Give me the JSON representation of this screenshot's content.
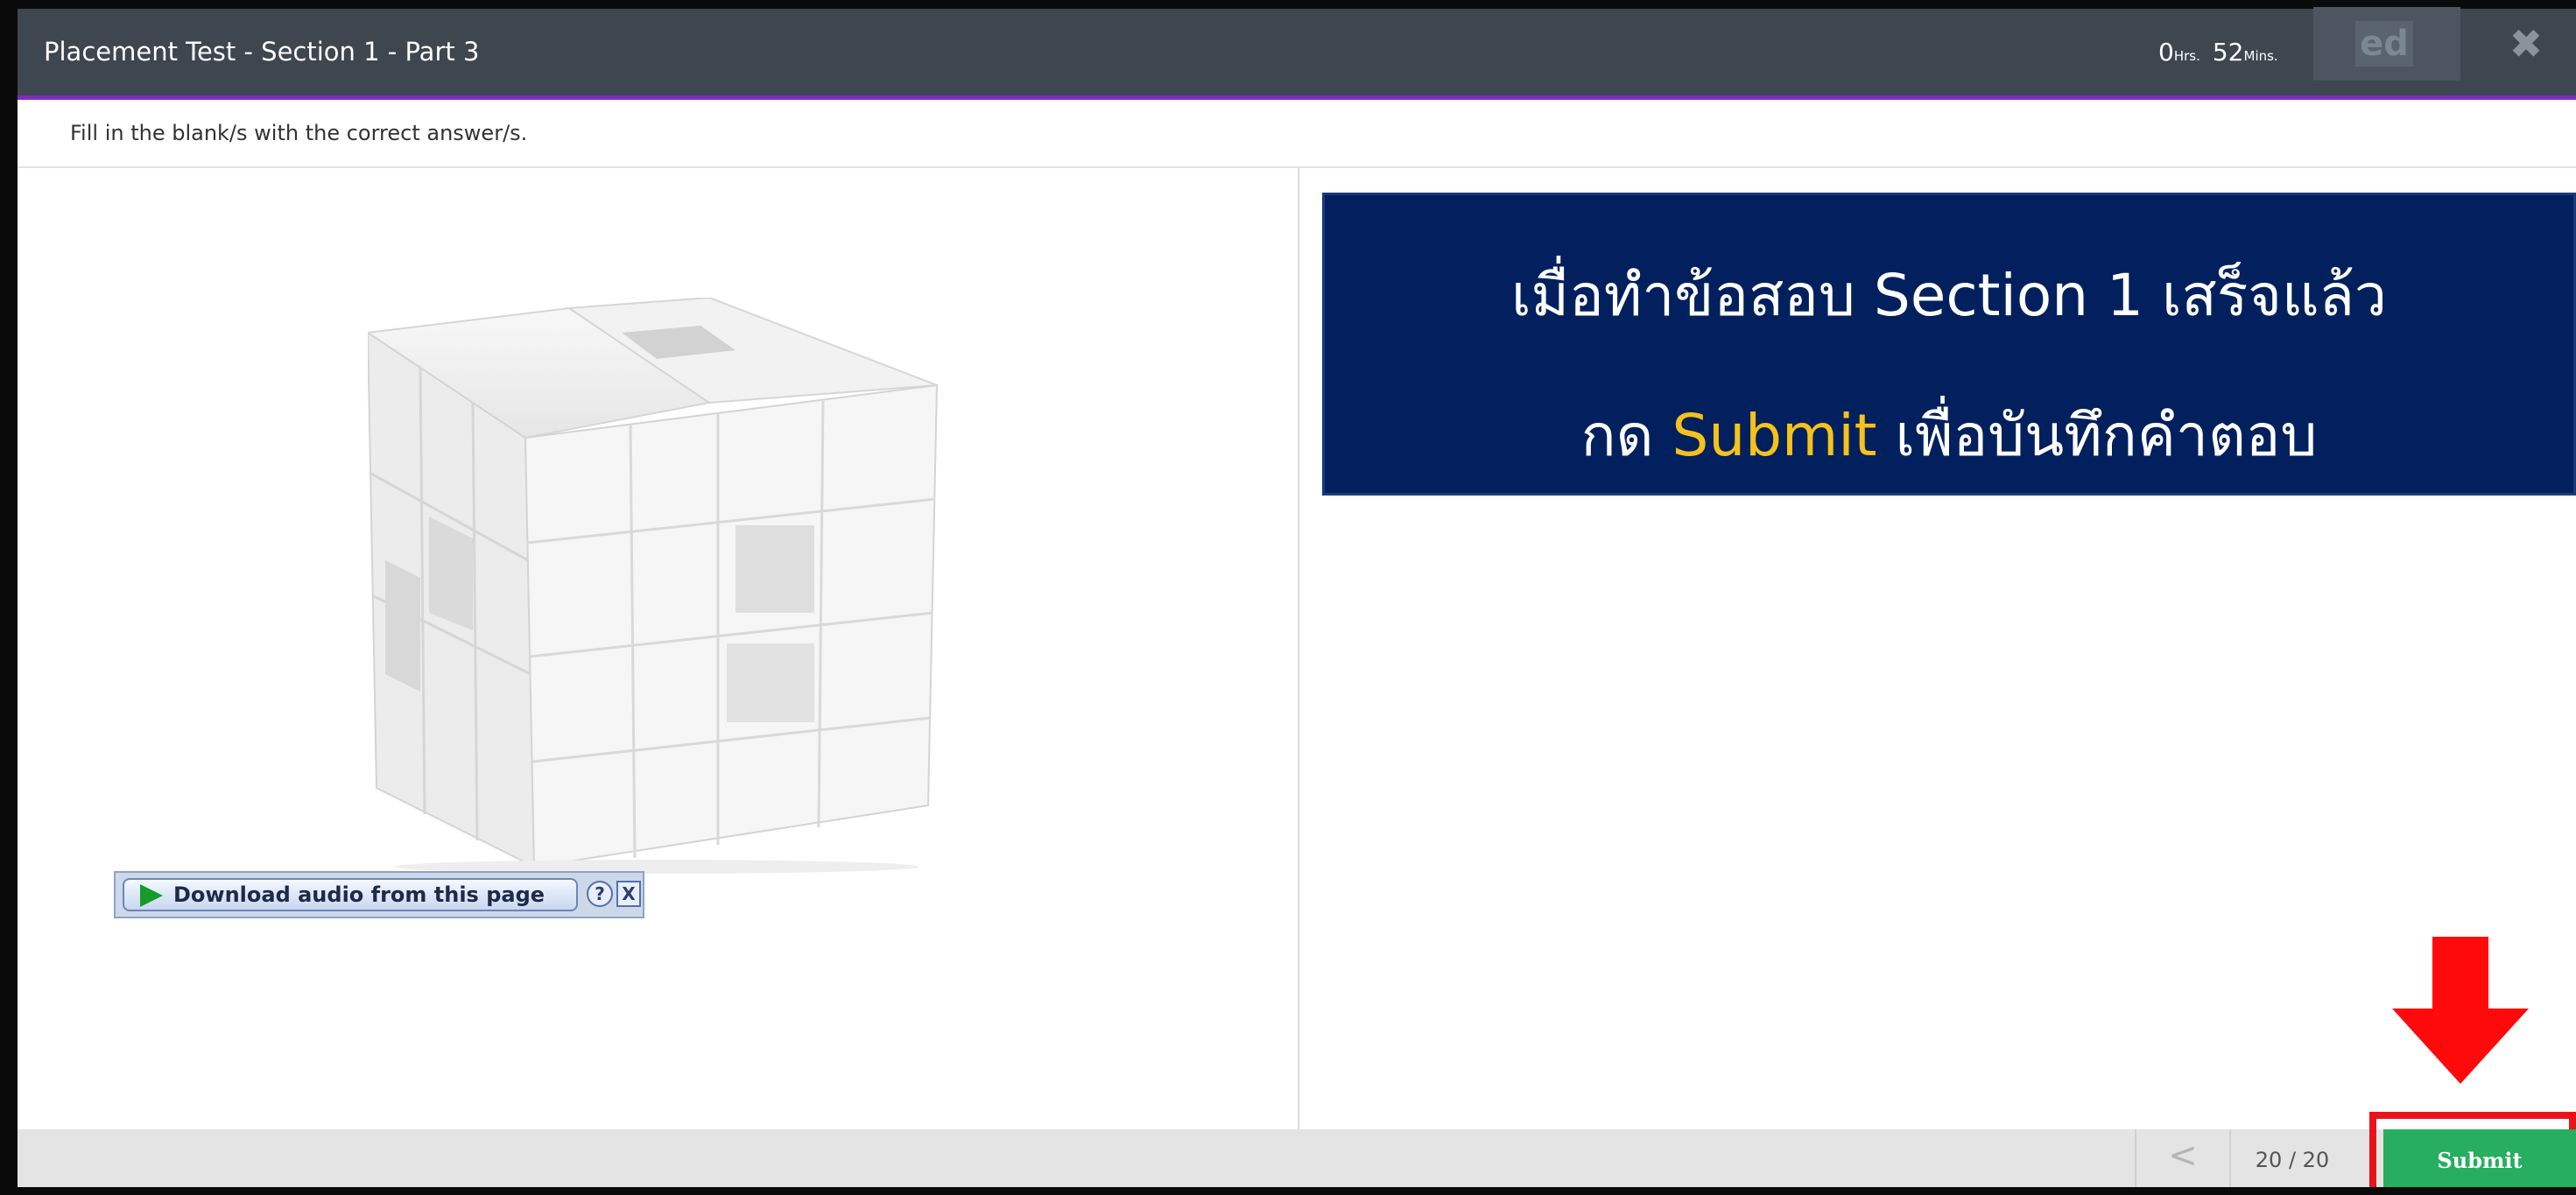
{
  "header": {
    "title": "Placement Test - Section 1 - Part 3",
    "timer": {
      "hours": "0",
      "hours_unit": "Hrs.",
      "minutes": "52",
      "minutes_unit": "Mins."
    },
    "logo_text": "ed",
    "close_glyph": "✖"
  },
  "instruction": {
    "text": "Fill in the blank/s with the correct answer/s."
  },
  "audio_widget": {
    "button_label": "Download audio from this page",
    "help_glyph": "?",
    "close_glyph": "X"
  },
  "annotation": {
    "line1": "เมื่อทำข้อสอบ Section 1 เสร็จแล้ว",
    "line2_prefix": "กด ",
    "line2_highlight": "Submit",
    "line2_suffix": " เพื่อบันทึกคำตอบ",
    "background_color": "#02205e",
    "highlight_color": "#f5c21b"
  },
  "footer": {
    "prev_glyph": "<",
    "page_counter": "20 / 20",
    "submit_label": "Submit"
  },
  "colors": {
    "header_bg": "#3e4650",
    "header_accent": "#7b2fb5",
    "submit_green": "#27ae60",
    "highlight_red": "#e8141b"
  },
  "icons": [
    "close-icon",
    "play-icon",
    "help-icon",
    "audio-close-icon",
    "chevron-left-icon",
    "arrow-down-icon"
  ]
}
